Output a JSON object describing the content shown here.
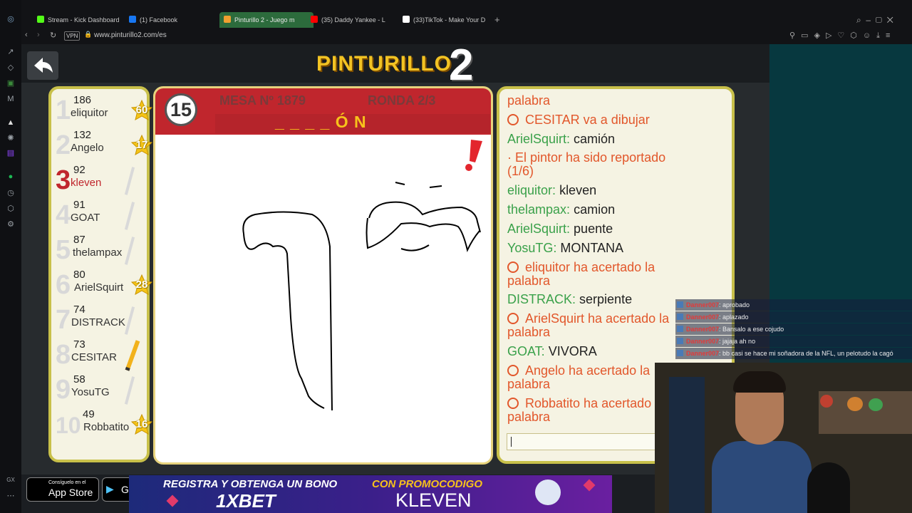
{
  "browser": {
    "tabs": [
      {
        "label": "Stream - Kick Dashboard",
        "color": "#53fc18"
      },
      {
        "label": "(1) Facebook",
        "color": "#1877f2"
      },
      {
        "label": "Pinturillo 2 - Juego m",
        "color": "#f0a030"
      },
      {
        "label": "(35) Daddy Yankee - L",
        "color": "#ff0000"
      },
      {
        "label": "(33)TikTok - Make Your D",
        "color": "#ffffff"
      }
    ],
    "new_tab": "+",
    "vpn_badge": "VPN",
    "url": "www.pinturillo2.com/es"
  },
  "game": {
    "logo": "PINTURILLO",
    "logo_number": "2",
    "timer": "15",
    "table_label": "MESA Nº 1879",
    "round_label": "RONDA 2/3",
    "word_hint": "_ _ _ _ Ó N",
    "report_icon": "exclamation-icon",
    "players": [
      {
        "rank": "1",
        "score": "186",
        "name": "eliquitor",
        "badge": "60",
        "color": "#d8d8d8"
      },
      {
        "rank": "2",
        "score": "132",
        "name": "Angelo",
        "badge": "17",
        "color": "#d8d8d8"
      },
      {
        "rank": "3",
        "score": "92",
        "name": "kleven",
        "badge": "",
        "color": "#c0262d"
      },
      {
        "rank": "4",
        "score": "91",
        "name": "GOAT",
        "badge": "",
        "color": "#d8d8d8"
      },
      {
        "rank": "5",
        "score": "87",
        "name": "thelampax",
        "badge": "",
        "color": "#d8d8d8"
      },
      {
        "rank": "6",
        "score": "80",
        "name": "ArielSquirt",
        "badge": "28",
        "color": "#d8d8d8"
      },
      {
        "rank": "7",
        "score": "74",
        "name": "DISTRACK",
        "badge": "",
        "color": "#d8d8d8"
      },
      {
        "rank": "8",
        "score": "73",
        "name": "CESITAR",
        "badge": "",
        "color": "#d8d8d8"
      },
      {
        "rank": "9",
        "score": "58",
        "name": "YosuTG",
        "badge": "",
        "color": "#d8d8d8"
      },
      {
        "rank": "10",
        "score": "49",
        "name": "Robbatito",
        "badge": "16",
        "color": "#d8d8d8"
      }
    ],
    "chat": [
      {
        "type": "sys",
        "user": "",
        "text": "palabra"
      },
      {
        "type": "sys",
        "user": "",
        "text": "CESITAR va a dibujar"
      },
      {
        "type": "msg",
        "user": "ArielSquirt:",
        "text": "camión"
      },
      {
        "type": "sys",
        "user": "",
        "text": "· El pintor ha sido reportado"
      },
      {
        "type": "sys",
        "user": "",
        "text": "(1/6)"
      },
      {
        "type": "msg",
        "user": "eliquitor:",
        "text": "kleven"
      },
      {
        "type": "msg",
        "user": "thelampax:",
        "text": "camion"
      },
      {
        "type": "msg",
        "user": "ArielSquirt:",
        "text": "puente"
      },
      {
        "type": "msg",
        "user": "YosuTG:",
        "text": "MONTANA"
      },
      {
        "type": "sys",
        "user": "",
        "text": "eliquitor ha acertado la"
      },
      {
        "type": "sys",
        "user": "",
        "text": "palabra"
      },
      {
        "type": "msg",
        "user": "DISTRACK:",
        "text": "serpiente"
      },
      {
        "type": "sys",
        "user": "",
        "text": "ArielSquirt ha acertado la"
      },
      {
        "type": "sys",
        "user": "",
        "text": "palabra"
      },
      {
        "type": "msg",
        "user": "GOAT:",
        "text": "VIVORA"
      },
      {
        "type": "sys",
        "user": "",
        "text": "Angelo ha acertado la"
      },
      {
        "type": "sys",
        "user": "",
        "text": "palabra"
      },
      {
        "type": "sys",
        "user": "",
        "text": "Robbatito ha acertado la"
      },
      {
        "type": "sys",
        "user": "",
        "text": "palabra"
      }
    ],
    "chat_input_value": ""
  },
  "stream_chat": [
    {
      "user": "Danner007",
      "text": ": aprobado"
    },
    {
      "user": "Danner007",
      "text": ": aplazado"
    },
    {
      "user": "Danner007",
      "text": ": Bansalo a ese cojudo"
    },
    {
      "user": "Danner007",
      "text": ": jajaja ah no"
    },
    {
      "user": "Danner007",
      "text": ": bb casi se hace mi soñadora de la NFL, un pelotudo la cagó"
    }
  ],
  "footer": {
    "appstore_small": "Consíguelo en el",
    "appstore_big": "App Store",
    "googleplay_big": "G",
    "ad_line1": "REGISTRA Y OBTENGA UN BONO",
    "ad_brand": "1XBET",
    "ad_promo_label": "CON PROMOCODIGO",
    "ad_code": "KLEVEN"
  },
  "colors": {
    "panel_bg": "#f5f3e3",
    "panel_border": "#c8c04a",
    "header_red": "#c0262d",
    "hint_yellow": "#f7c21b",
    "sys_text": "#e2572b",
    "user_text": "#3aa14a"
  }
}
